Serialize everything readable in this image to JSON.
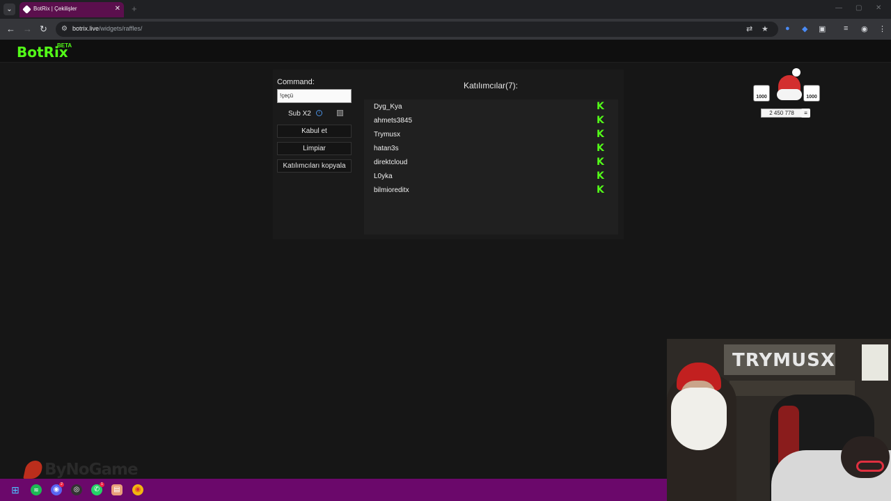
{
  "browser": {
    "tab_title": "BotRix | Çekilişler",
    "url_host": "botrix.live",
    "url_path": "/widgets/raffles/"
  },
  "header": {
    "logo": "BotRix",
    "logo_badge": "BETA"
  },
  "raffle": {
    "command_label": "Command:",
    "command_value": "!çeçü",
    "sub_label": "Sub X2",
    "sub_checked": false,
    "accept_button": "Kabul et",
    "clear_button": "Limpiar",
    "copy_button": "Katılımcıları kopyala",
    "participants_title": "Katılımcılar(7):",
    "participants": [
      {
        "name": "Dyg_Kya",
        "platform_icon": "kick-icon"
      },
      {
        "name": "ahmets3845",
        "platform_icon": "kick-icon"
      },
      {
        "name": "Trymusx",
        "platform_icon": "kick-icon"
      },
      {
        "name": "hatan3s",
        "platform_icon": "kick-icon"
      },
      {
        "name": "direktcloud",
        "platform_icon": "kick-icon"
      },
      {
        "name": "L0yka",
        "platform_icon": "kick-icon"
      },
      {
        "name": "bilmioreditx",
        "platform_icon": "kick-icon"
      }
    ]
  },
  "overlay": {
    "left_badge": "1000",
    "right_badge": "1000",
    "counter": "2 450 778"
  },
  "stream": {
    "sponsor": "ByNoGame",
    "webcam_sign": "TRYMUSX"
  },
  "taskbar": {
    "discord_badge": "2",
    "whatsapp_badge": "1"
  },
  "colors": {
    "kick_green": "#53fc18",
    "tab_active": "#5b0f4d",
    "taskbar": "#6b086b"
  }
}
